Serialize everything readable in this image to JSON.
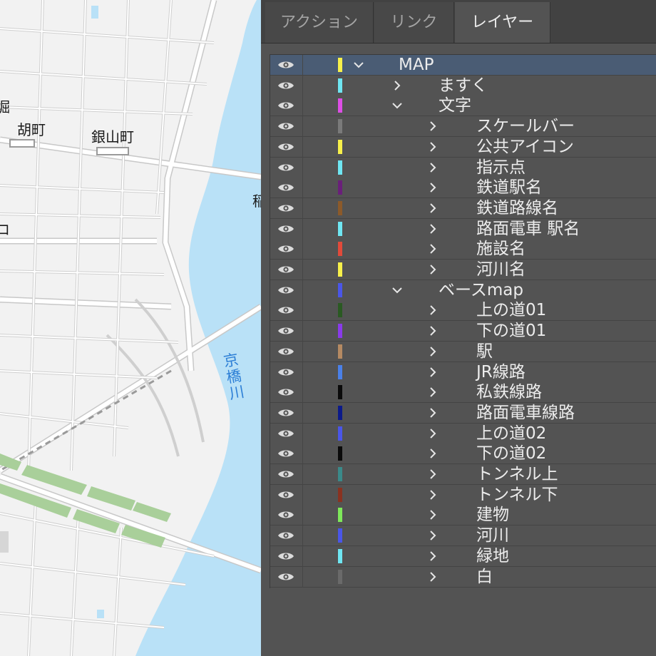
{
  "map": {
    "labels": {
      "l1": "胡町",
      "l2": "銀山町",
      "l3": "京橋川",
      "edge_left_top": "堀",
      "edge_left_mid": "ロ",
      "edge_right": "稲"
    },
    "colors": {
      "land": "#f2f2f2",
      "road": "#ffffff",
      "road_outline": "#c8c8c8",
      "river": "#b9e1f7",
      "park": "#a9cf9a",
      "label_river": "#2d7fd6"
    }
  },
  "panel": {
    "tabs": [
      {
        "label": "アクション"
      },
      {
        "label": "リンク"
      },
      {
        "label": "レイヤー"
      }
    ],
    "active_tab": "レイヤー",
    "layers": [
      {
        "name": "MAP",
        "depth": 0,
        "expanded": true,
        "color": "#f7f04a",
        "selected": true
      },
      {
        "name": "ますく",
        "depth": 1,
        "expanded": false,
        "color": "#6fe6f2"
      },
      {
        "name": "文字",
        "depth": 1,
        "expanded": true,
        "color": "#dd4ee6"
      },
      {
        "name": "スケールバー",
        "depth": 2,
        "expanded": false,
        "color": "#7a7a7a"
      },
      {
        "name": "公共アイコン",
        "depth": 2,
        "expanded": false,
        "color": "#f7f04a"
      },
      {
        "name": "指示点",
        "depth": 2,
        "expanded": false,
        "color": "#6fe6f2"
      },
      {
        "name": "鉄道駅名",
        "depth": 2,
        "expanded": false,
        "color": "#6a1f7a"
      },
      {
        "name": "鉄道路線名",
        "depth": 2,
        "expanded": false,
        "color": "#8c5a2a"
      },
      {
        "name": "路面電車 駅名",
        "depth": 2,
        "expanded": false,
        "color": "#6fe6f2"
      },
      {
        "name": "施設名",
        "depth": 2,
        "expanded": false,
        "color": "#e24a3a"
      },
      {
        "name": "河川名",
        "depth": 2,
        "expanded": false,
        "color": "#f7f04a"
      },
      {
        "name": "ベースmap",
        "depth": 1,
        "expanded": true,
        "color": "#4a56e8"
      },
      {
        "name": "上の道01",
        "depth": 2,
        "expanded": false,
        "color": "#2a5a22"
      },
      {
        "name": "下の道01",
        "depth": 2,
        "expanded": false,
        "color": "#8a3aea"
      },
      {
        "name": "駅",
        "depth": 2,
        "expanded": false,
        "color": "#b58a62"
      },
      {
        "name": "JR線路",
        "depth": 2,
        "expanded": false,
        "color": "#4a80e8"
      },
      {
        "name": "私鉄線路",
        "depth": 2,
        "expanded": false,
        "color": "#0a0a0a"
      },
      {
        "name": "路面電車線路",
        "depth": 2,
        "expanded": false,
        "color": "#0c1a8a"
      },
      {
        "name": "上の道02",
        "depth": 2,
        "expanded": false,
        "color": "#4a56e8"
      },
      {
        "name": "下の道02",
        "depth": 2,
        "expanded": false,
        "color": "#0a0a0a"
      },
      {
        "name": "トンネル上",
        "depth": 2,
        "expanded": false,
        "color": "#3a8a8a"
      },
      {
        "name": "トンネル下",
        "depth": 2,
        "expanded": false,
        "color": "#8a3220"
      },
      {
        "name": "建物",
        "depth": 2,
        "expanded": false,
        "color": "#7ee85a"
      },
      {
        "name": "河川",
        "depth": 2,
        "expanded": false,
        "color": "#4a56e8"
      },
      {
        "name": "緑地",
        "depth": 2,
        "expanded": false,
        "color": "#6fe6f2"
      },
      {
        "name": "白",
        "depth": 2,
        "expanded": false,
        "color": "#6a6a6a"
      }
    ]
  }
}
